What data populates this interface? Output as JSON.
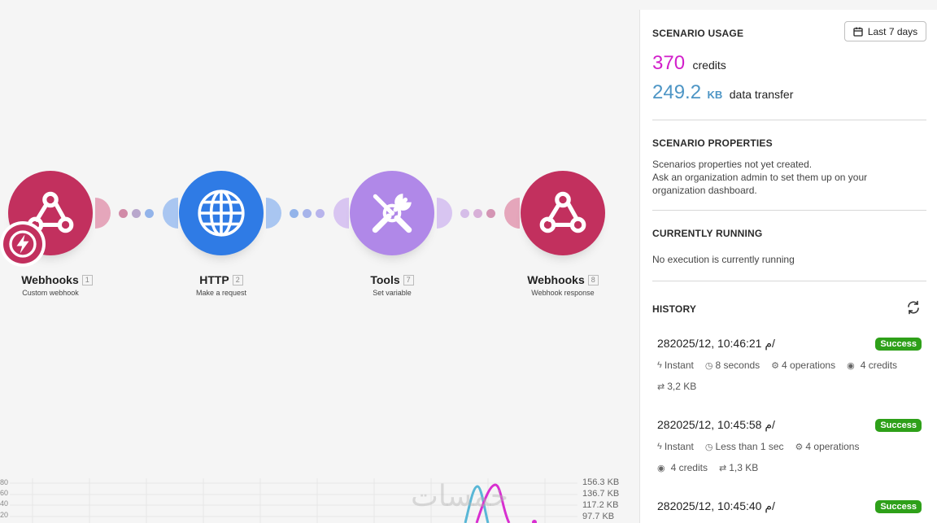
{
  "modules": [
    {
      "name": "Webhooks",
      "num": "1",
      "sub": "Custom webhook",
      "color": "#c2305e",
      "icon": "webhook-icon"
    },
    {
      "name": "HTTP",
      "num": "2",
      "sub": "Make a request",
      "color": "#2f7be5",
      "icon": "globe-icon"
    },
    {
      "name": "Tools",
      "num": "7",
      "sub": "Set variable",
      "color": "#b088e8",
      "icon": "tools-icon"
    },
    {
      "name": "Webhooks",
      "num": "8",
      "sub": "Webhook response",
      "color": "#c2305e",
      "icon": "webhook-icon"
    }
  ],
  "trigger_icon": "lightning-icon",
  "chart": {
    "left_ticks": [
      "80",
      "60",
      "40",
      "20"
    ],
    "right_ticks": [
      "156.3 KB",
      "136.7 KB",
      "117.2 KB",
      "97.7 KB"
    ],
    "series_colors": [
      "#59b7d6",
      "#d82fd0"
    ]
  },
  "watermark": "خمسات",
  "panel": {
    "usage": {
      "title": "SCENARIO USAGE",
      "date_range": "Last 7 days",
      "credits_value": "370",
      "credits_label": "credits",
      "credits_color": "#d21fca",
      "transfer_value": "249.2",
      "transfer_unit": "KB",
      "transfer_label": "data transfer",
      "transfer_color": "#4d95c5"
    },
    "properties": {
      "title": "SCENARIO PROPERTIES",
      "line1": "Scenarios properties not yet created.",
      "line2": "Ask an organization admin to set them up on your",
      "line3": "organization dashboard."
    },
    "running": {
      "title": "CURRENTLY RUNNING",
      "text": "No execution is currently running"
    },
    "history": {
      "title": "HISTORY",
      "items": [
        {
          "date": "28م 10:46:21 ,2025/12/",
          "status": "Success",
          "trigger": "Instant",
          "duration": "8 seconds",
          "operations": "4 operations",
          "credits": "4 credits",
          "transfer": "3,2 KB"
        },
        {
          "date": "28م 10:45:58 ,2025/12/",
          "status": "Success",
          "trigger": "Instant",
          "duration": "Less than 1 sec",
          "operations": "4 operations",
          "credits": "4 credits",
          "transfer": "1,3 KB"
        },
        {
          "date": "28م 10:45:40 ,2025/12/",
          "status": "Success"
        }
      ]
    }
  }
}
